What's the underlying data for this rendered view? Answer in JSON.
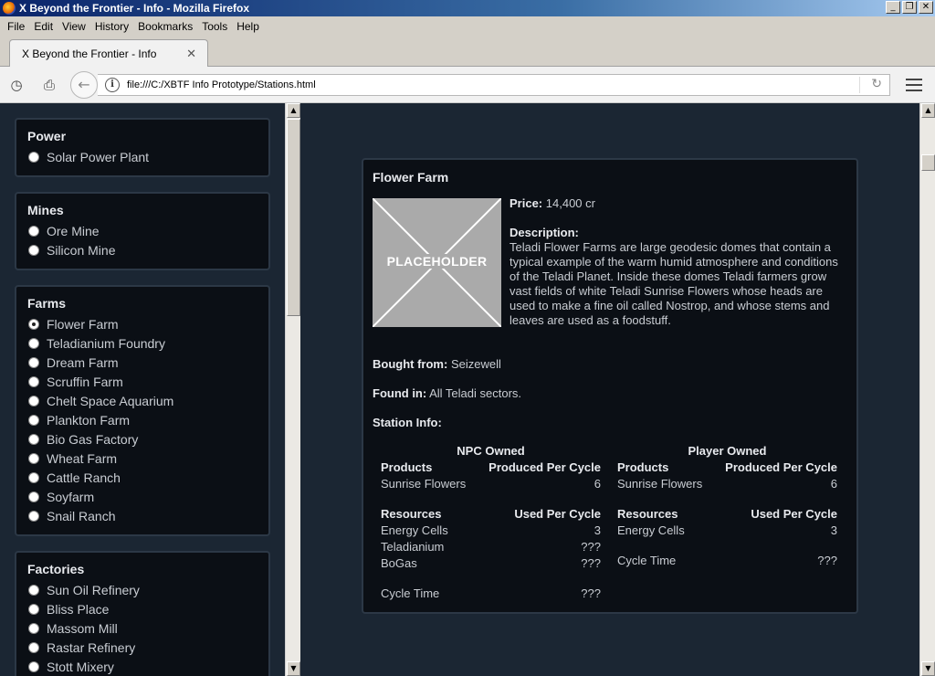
{
  "window": {
    "title": "X Beyond the Frontier - Info - Mozilla Firefox"
  },
  "menu": [
    "File",
    "Edit",
    "View",
    "History",
    "Bookmarks",
    "Tools",
    "Help"
  ],
  "tab": {
    "title": "X Beyond the Frontier - Info"
  },
  "url": "file:///C:/XBTF Info Prototype/Stations.html",
  "sidebar": {
    "groups": [
      {
        "title": "Power",
        "items": [
          "Solar Power Plant"
        ]
      },
      {
        "title": "Mines",
        "items": [
          "Ore Mine",
          "Silicon Mine"
        ]
      },
      {
        "title": "Farms",
        "items": [
          "Flower Farm",
          "Teladianium Foundry",
          "Dream Farm",
          "Scruffin Farm",
          "Chelt Space Aquarium",
          "Plankton Farm",
          "Bio Gas Factory",
          "Wheat Farm",
          "Cattle Ranch",
          "Soyfarm",
          "Snail Ranch"
        ]
      },
      {
        "title": "Factories",
        "items": [
          "Sun Oil Refinery",
          "Bliss Place",
          "Massom Mill",
          "Rastar Refinery",
          "Stott Mixery"
        ]
      }
    ],
    "selected": "Flower Farm"
  },
  "station": {
    "name": "Flower Farm",
    "placeholder": "PLACEHOLDER",
    "price_label": "Price:",
    "price": "14,400 cr",
    "description_label": "Description:",
    "description": "Teladi Flower Farms are large geodesic domes that contain a typical example of the warm humid atmosphere and conditions of the Teladi Planet. Inside these domes Teladi farmers grow vast fields of white Teladi Sunrise Flowers whose heads are used to make a fine oil called Nostrop, and whose stems and leaves are used as a foodstuff.",
    "bought_label": "Bought from:",
    "bought_from": "Seizewell",
    "found_label": "Found in:",
    "found_in": "All Teladi sectors.",
    "info_label": "Station Info:",
    "npc": {
      "heading": "NPC Owned",
      "products_header": [
        "Products",
        "Produced Per Cycle"
      ],
      "products": [
        [
          "Sunrise Flowers",
          "6"
        ]
      ],
      "resources_header": [
        "Resources",
        "Used Per Cycle"
      ],
      "resources": [
        [
          "Energy Cells",
          "3"
        ],
        [
          "Teladianium",
          "???"
        ],
        [
          "BoGas",
          "???"
        ]
      ],
      "cycle": [
        "Cycle Time",
        "???"
      ]
    },
    "player": {
      "heading": "Player Owned",
      "products_header": [
        "Products",
        "Produced Per Cycle"
      ],
      "products": [
        [
          "Sunrise Flowers",
          "6"
        ]
      ],
      "resources_header": [
        "Resources",
        "Used Per Cycle"
      ],
      "resources": [
        [
          "Energy Cells",
          "3"
        ]
      ],
      "cycle": [
        "Cycle Time",
        "???"
      ]
    }
  }
}
